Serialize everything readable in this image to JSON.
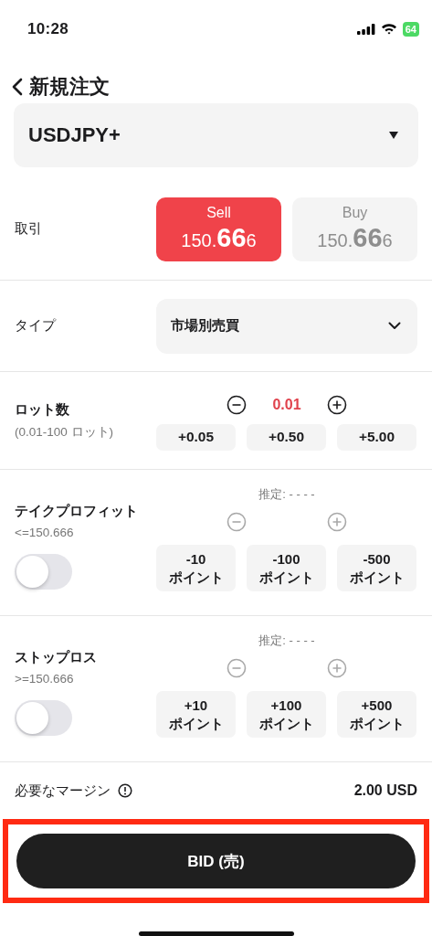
{
  "status_bar": {
    "time": "10:28",
    "battery": "64"
  },
  "header": {
    "title": "新規注文"
  },
  "symbol": {
    "value": "USDJPY+"
  },
  "trade": {
    "label": "取引",
    "sides": [
      {
        "label": "Sell",
        "price_head": "150.",
        "price_big": "66",
        "price_tail": "6",
        "selected": true
      },
      {
        "label": "Buy",
        "price_head": "150.",
        "price_big": "66",
        "price_tail": "6",
        "selected": false
      }
    ]
  },
  "order_type": {
    "label": "タイプ",
    "value": "市場別売買"
  },
  "lots": {
    "label": "ロット数",
    "range": "(0.01-100 ロット)",
    "value": "0.01",
    "steppers_disabled": false,
    "increments": [
      "+0.05",
      "+0.50",
      "+5.00"
    ]
  },
  "take_profit": {
    "label": "テイクプロフィット",
    "limit": "<=150.666",
    "estimate": "推定: - - - -",
    "on": false,
    "steppers_disabled": true,
    "increments": [
      "-10 ポイント",
      "-100 ポイント",
      "-500 ポイント"
    ]
  },
  "stop_loss": {
    "label": "ストップロス",
    "limit": ">=150.666",
    "estimate": "推定: - - - -",
    "on": false,
    "steppers_disabled": true,
    "increments": [
      "+10 ポイント",
      "+100 ポイント",
      "+500 ポイント"
    ]
  },
  "margin": {
    "label": "必要なマージン",
    "value": "2.00 USD"
  },
  "submit": {
    "label": "BID (売)",
    "highlighted": true
  }
}
